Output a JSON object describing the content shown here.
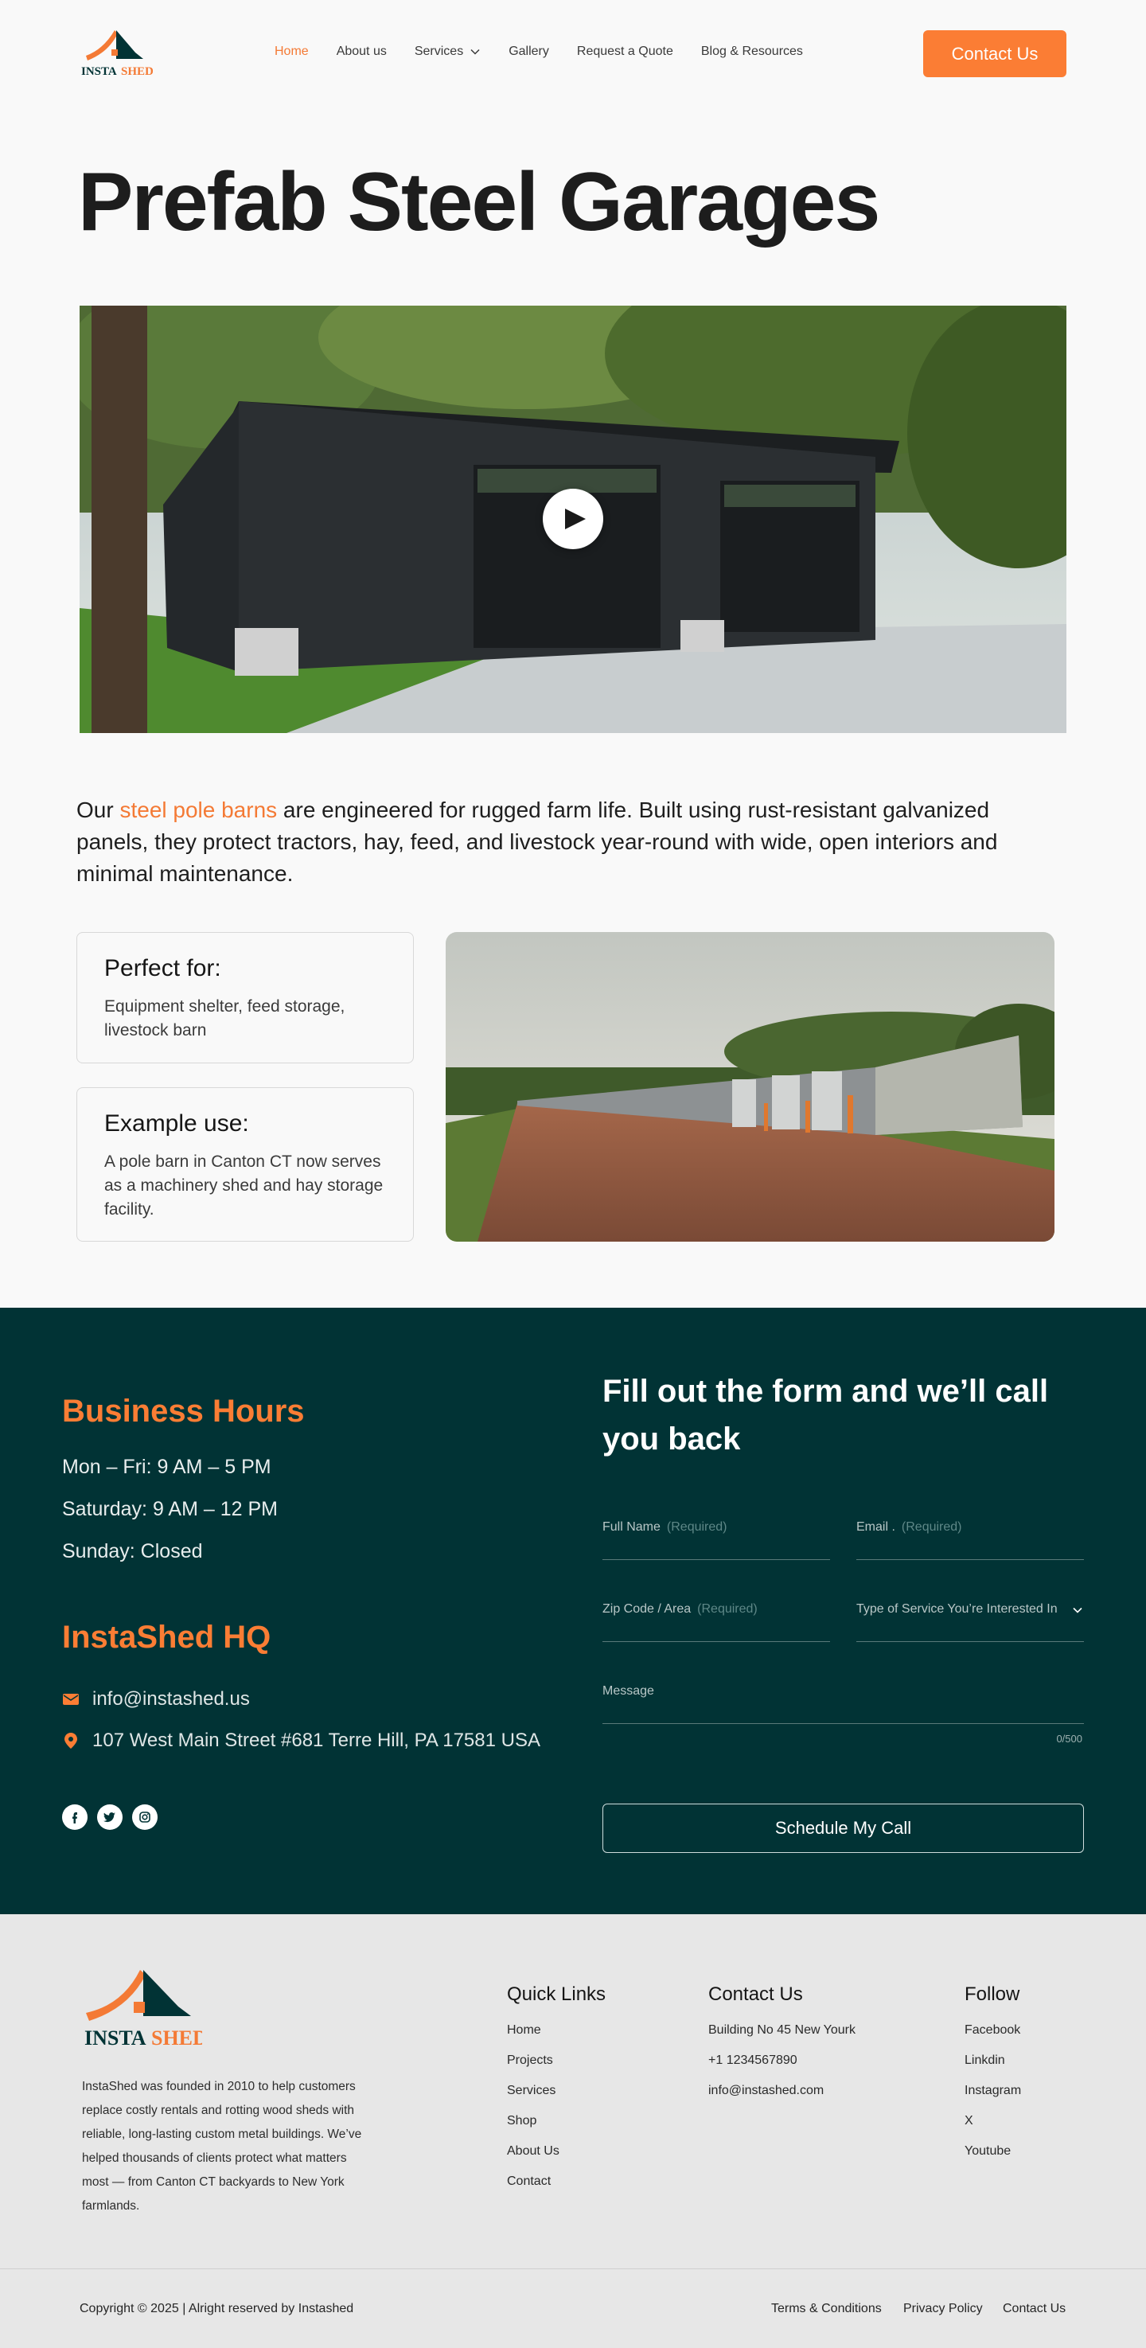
{
  "colors": {
    "accent": "#fb7d34",
    "dark_teal": "#013335",
    "footer_bg": "#e7e7e7"
  },
  "brand": {
    "logo_text_left": "INSTA",
    "logo_text_right": "SHED"
  },
  "nav": {
    "items": [
      {
        "label": "Home",
        "active": true
      },
      {
        "label": "About us"
      },
      {
        "label": "Services",
        "has_dropdown": true
      },
      {
        "label": "Gallery"
      },
      {
        "label": "Request a Quote"
      },
      {
        "label": "Blog & Resources"
      }
    ],
    "cta": "Contact Us"
  },
  "hero": {
    "title": "Prefab Steel Garages",
    "play_icon": "play-icon"
  },
  "intro": {
    "prefix": "Our ",
    "highlight": "steel pole barns",
    "rest": " are engineered for rugged farm life. Built using rust-resistant galvanized panels, they protect tractors, hay, feed, and livestock year-round with wide, open interiors and minimal maintenance."
  },
  "cards": [
    {
      "title": "Perfect for:",
      "body": "Equipment shelter, feed storage, livestock barn"
    },
    {
      "title": "Example use:",
      "body": "A pole barn in Canton CT now serves as a machinery shed and hay storage facility."
    }
  ],
  "contact": {
    "hours_title": "Business Hours",
    "hours": [
      "Mon – Fri: 9 AM – 5 PM",
      "Saturday: 9 AM – 12 PM",
      "Sunday: Closed"
    ],
    "hq_title": "InstaShed HQ",
    "email": "info@instashed.us",
    "address": "107 West Main Street #681 Terre Hill, PA 17581 USA",
    "socials": [
      "facebook-icon",
      "twitter-icon",
      "instagram-icon"
    ],
    "form": {
      "title": "Fill out the form and we’ll call you back",
      "full_name": "Full Name",
      "email": "Email .",
      "zip": "Zip Code / Area",
      "service": "Type of Service You’re Interested In",
      "message": "Message",
      "required": "(Required)",
      "counter": "0/500",
      "submit": "Schedule My Call"
    }
  },
  "footer": {
    "about": "InstaShed was founded in 2010 to help customers replace costly rentals and rotting wood sheds with reliable, long-lasting custom metal buildings. We’ve helped thousands of clients protect what matters most — from Canton CT backyards to New York farmlands.",
    "quick_links": {
      "title": "Quick Links",
      "items": [
        "Home",
        "Projects",
        "Services",
        "Shop",
        "About Us",
        "Contact"
      ]
    },
    "contact_us": {
      "title": "Contact Us",
      "items": [
        "Building No 45 New Yourk",
        "+1 1234567890",
        "info@instashed.com"
      ]
    },
    "follow": {
      "title": "Follow",
      "items": [
        "Facebook",
        "Linkdin",
        "Instagram",
        "X",
        "Youtube"
      ]
    },
    "copyright": "Copyright © 2025 | Alright reserved by  Instashed",
    "legal": [
      "Terms & Conditions",
      "Privacy Policy",
      "Contact Us"
    ]
  }
}
